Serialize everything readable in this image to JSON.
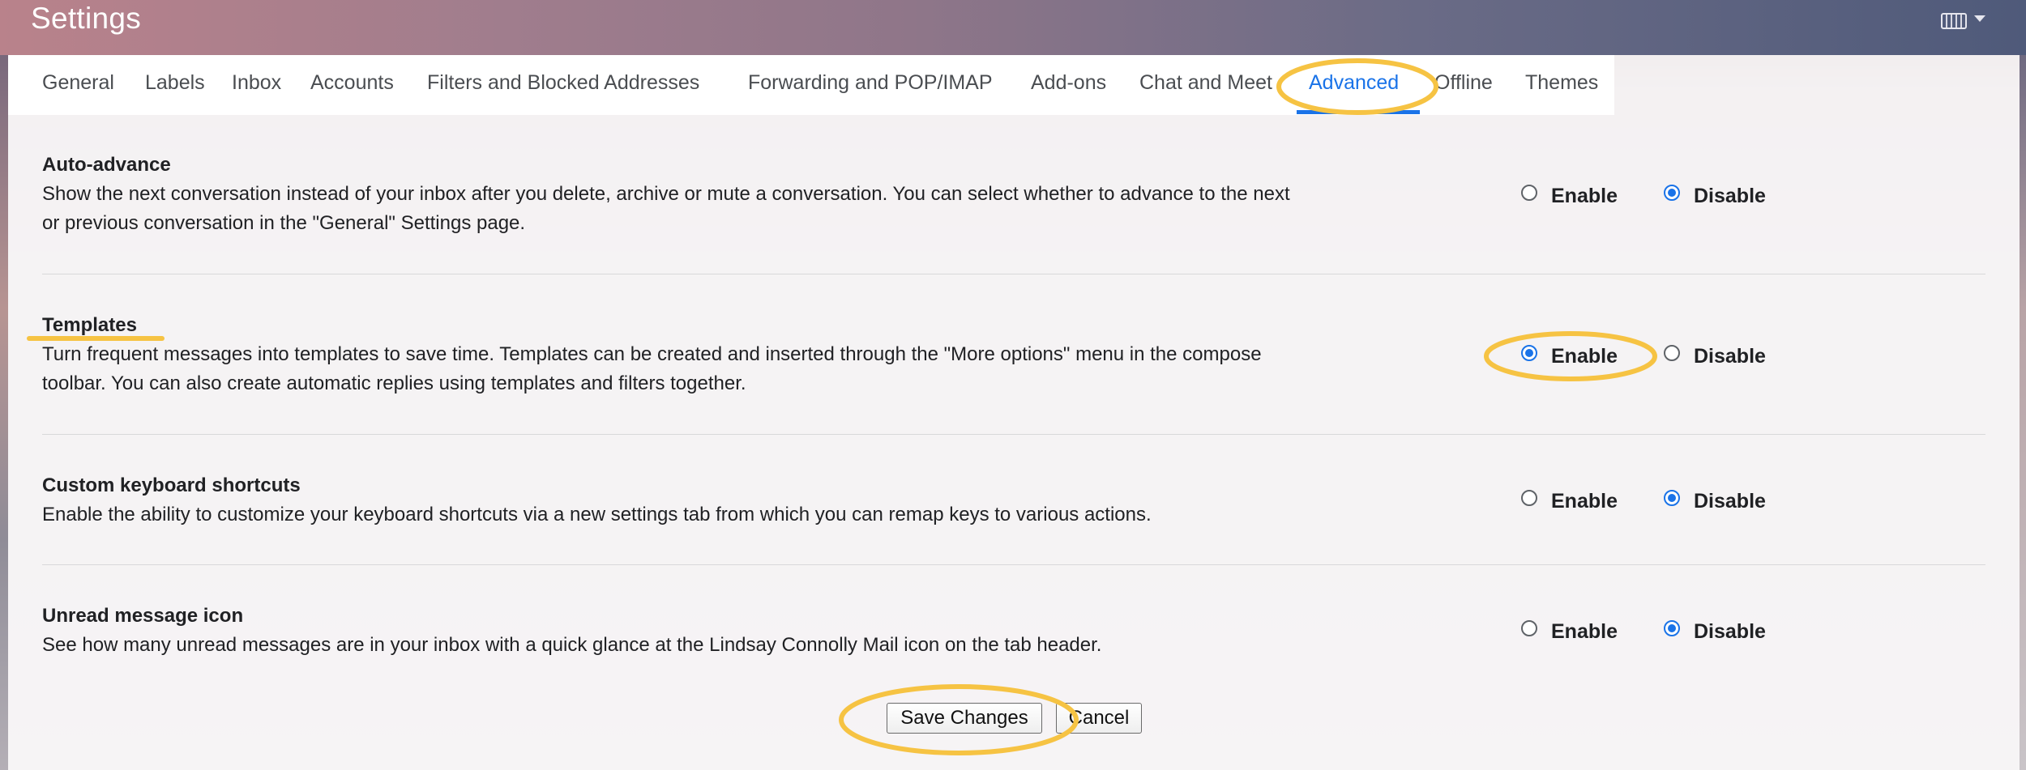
{
  "app": {
    "title": "Settings"
  },
  "icons": {
    "keyboard": "keyboard-icon",
    "dropdown": "chevron-down-icon"
  },
  "tabs": [
    {
      "label": "General"
    },
    {
      "label": "Labels"
    },
    {
      "label": "Inbox"
    },
    {
      "label": "Accounts"
    },
    {
      "label": "Filters and Blocked Addresses"
    },
    {
      "label": "Forwarding and POP/IMAP"
    },
    {
      "label": "Add-ons"
    },
    {
      "label": "Chat and Meet"
    },
    {
      "label": "Advanced",
      "active": true
    },
    {
      "label": "Offline"
    },
    {
      "label": "Themes"
    }
  ],
  "sections": [
    {
      "title": "Auto-advance",
      "desc_line1": "Show the next conversation instead of your inbox after you delete, archive or mute a conversation. You can select whether to advance to the next",
      "desc_line2": "or previous conversation in the \"General\" Settings page.",
      "enable_label": "Enable",
      "disable_label": "Disable",
      "selected": "Disable"
    },
    {
      "title": "Templates",
      "desc_line1": "Turn frequent messages into templates to save time. Templates can be created and inserted through the \"More options\" menu in the compose",
      "desc_line2": "toolbar. You can also create automatic replies using templates and filters together.",
      "enable_label": "Enable",
      "disable_label": "Disable",
      "selected": "Enable"
    },
    {
      "title": "Custom keyboard shortcuts",
      "desc_line1": "Enable the ability to customize your keyboard shortcuts via a new settings tab from which you can remap keys to various actions.",
      "enable_label": "Enable",
      "disable_label": "Disable",
      "selected": "Disable"
    },
    {
      "title": "Unread message icon",
      "desc_line1": "See how many unread messages are in your inbox with a quick glance at the Lindsay Connolly Mail icon on the tab header.",
      "enable_label": "Enable",
      "disable_label": "Disable",
      "selected": "Disable"
    }
  ],
  "buttons": {
    "save": "Save Changes",
    "cancel": "Cancel"
  },
  "colors": {
    "accent": "#1a73e8",
    "highlight": "#f6c343"
  }
}
